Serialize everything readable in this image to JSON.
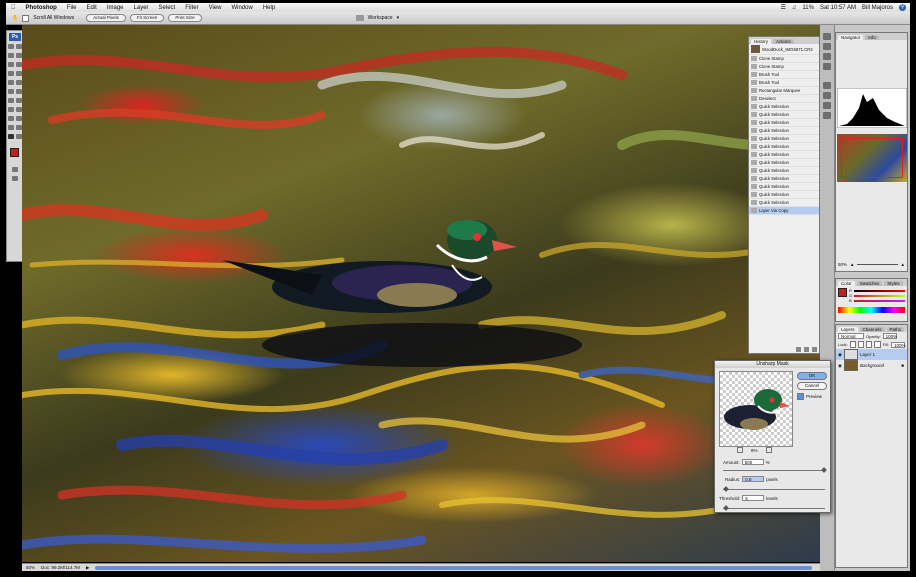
{
  "menubar": {
    "app": "Photoshop",
    "items": [
      "File",
      "Edit",
      "Image",
      "Layer",
      "Select",
      "Filter",
      "View",
      "Window",
      "Help"
    ],
    "clock": "Sat 10:57 AM",
    "user": "Bill Majoros",
    "volume": "11%"
  },
  "options": {
    "scroll_all": "Scroll All Windows",
    "actual_pixels": "Actual Pixels",
    "fit_screen": "Fit Screen",
    "print_size": "Print Size",
    "workspace": "Workspace"
  },
  "toolbox": {
    "logo": "Ps",
    "foreground_color": "#c41d1d"
  },
  "status": {
    "zoom": "50%",
    "doc": "Doc: 99.2M/114.7M"
  },
  "history": {
    "tabs": [
      "History",
      "Actions"
    ],
    "snapshot": "WoodDuck_IMG6871.CR2",
    "steps": [
      "Clone Stamp",
      "Clone Stamp",
      "Brush Tool",
      "Brush Tool",
      "Rectangular Marquee",
      "Deselect",
      "Quick Selection",
      "Quick Selection",
      "Quick Selection",
      "Quick Selection",
      "Quick Selection",
      "Quick Selection",
      "Quick Selection",
      "Quick Selection",
      "Quick Selection",
      "Quick Selection",
      "Quick Selection",
      "Quick Selection",
      "Quick Selection",
      "Layer Via Copy"
    ]
  },
  "navigator": {
    "tabs": [
      "Navigator",
      "Info"
    ],
    "zoom": "50%"
  },
  "color": {
    "tabs": [
      "Color",
      "Swatches",
      "Styles"
    ],
    "channels": [
      "R",
      "G",
      "B"
    ]
  },
  "layers": {
    "tabs": [
      "Layers",
      "Channels",
      "Paths"
    ],
    "blend": "Normal",
    "opacity_label": "Opacity:",
    "opacity": "100%",
    "fill_label": "Fill:",
    "fill": "100%",
    "lock_label": "Lock:",
    "items": [
      "Layer 1",
      "Background"
    ]
  },
  "dialog": {
    "title": "Unsharp Mask",
    "ok": "OK",
    "cancel": "Cancel",
    "preview": "Preview",
    "zoom": "8%",
    "amount_label": "Amount:",
    "amount": "500",
    "amount_unit": "%",
    "radius_label": "Radius:",
    "radius": "0.8",
    "radius_unit": "pixels",
    "threshold_label": "Threshold:",
    "threshold": "5",
    "threshold_unit": "levels"
  }
}
